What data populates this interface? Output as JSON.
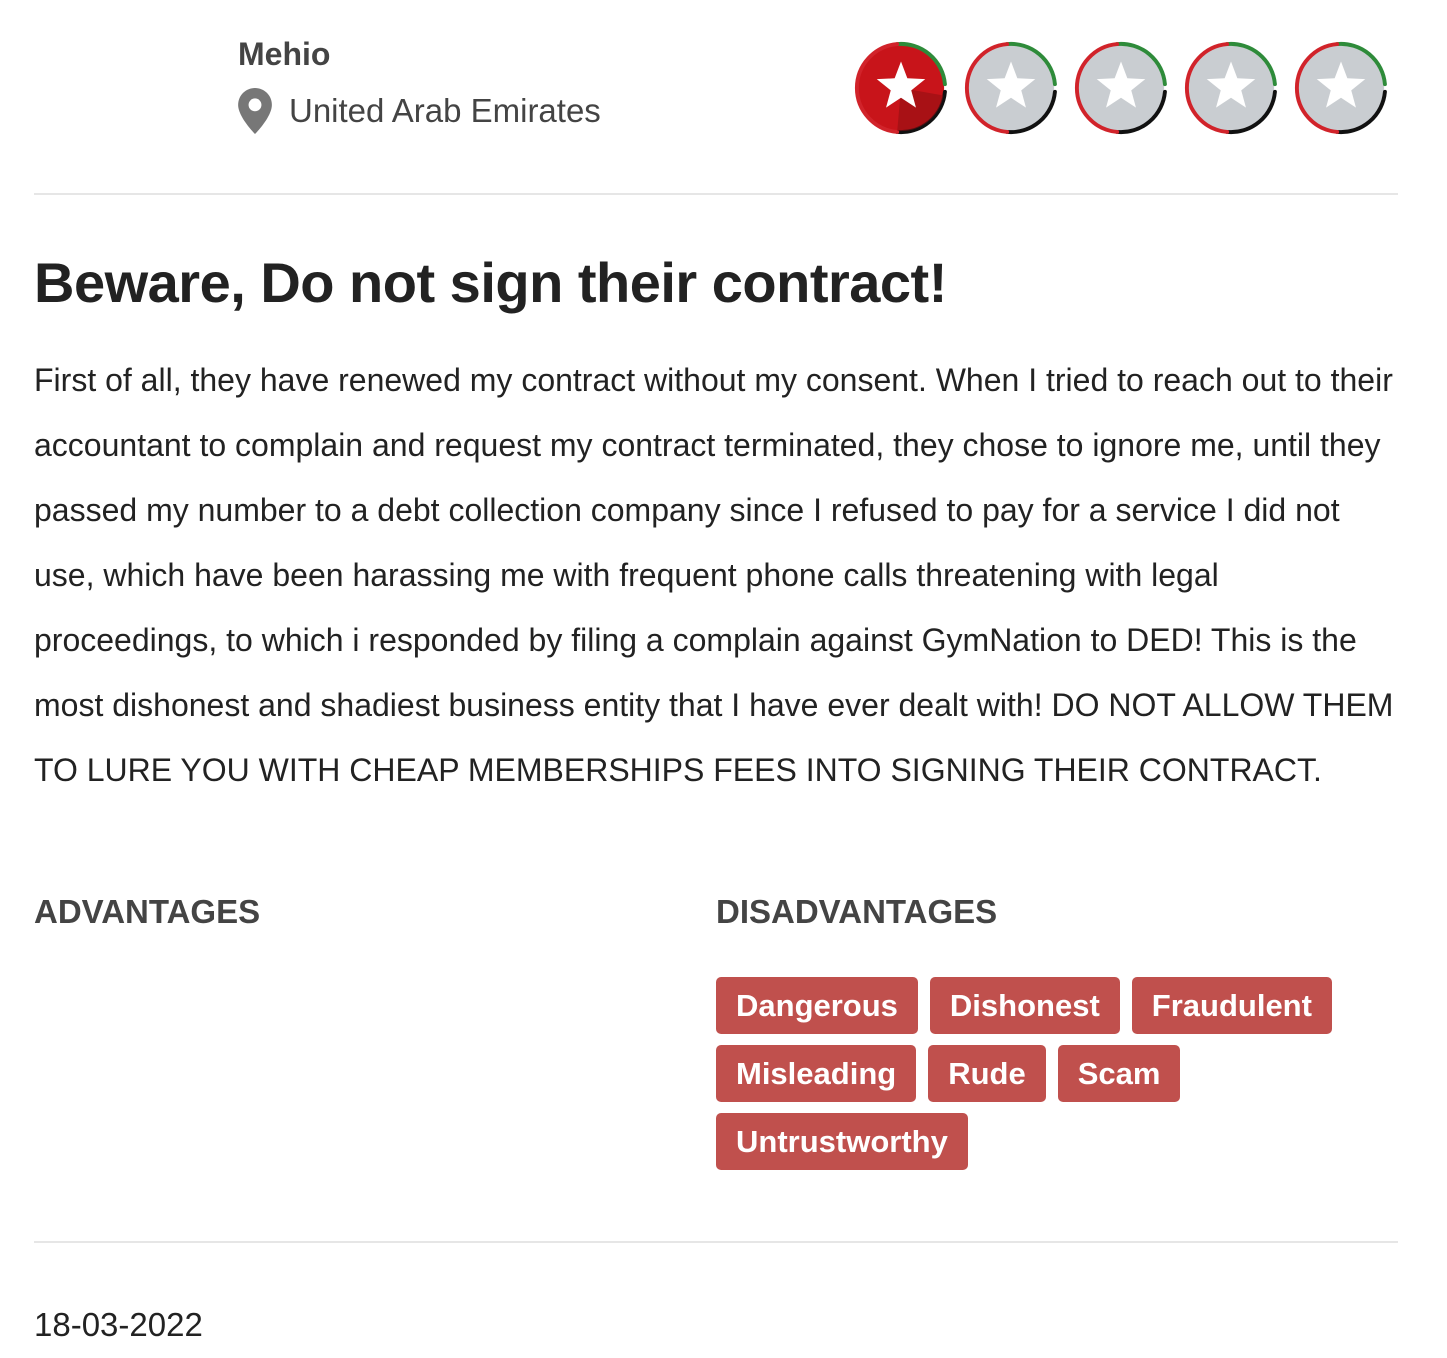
{
  "review": {
    "author": "Mehio",
    "location": "United Arab Emirates",
    "rating": 1,
    "rating_max": 5,
    "title": "Beware, Do not sign their contract!",
    "body": "First of all, they have renewed my contract without my consent. When I tried to reach out to their accountant to complain and request my contract terminated, they chose to ignore me, until they passed my number to a debt collection company since I refused to pay for a service I did not use, which have been harassing me with frequent phone calls threatening with legal proceedings, to which i responded by filing a complain against GymNation to DED! This is the most dishonest and shadiest business entity that I have ever dealt with! DO NOT ALLOW THEM TO LURE YOU WITH CHEAP MEMBERSHIPS FEES INTO SIGNING THEIR CONTRACT.",
    "advantages_heading": "ADVANTAGES",
    "disadvantages_heading": "DISADVANTAGES",
    "advantages": [],
    "disadvantages": [
      "Dangerous",
      "Dishonest",
      "Fraudulent",
      "Misleading",
      "Rude",
      "Scam",
      "Untrustworthy"
    ],
    "date": "18-03-2022"
  },
  "colors": {
    "tag_bg": "#c0504d",
    "star_active": "#c8141a",
    "star_inactive": "#c9cdd1",
    "ring_green": "#2e8b3a",
    "ring_red": "#d1232a",
    "ring_black": "#111111"
  },
  "icons": {
    "location": "map-pin-icon",
    "star": "star-icon"
  }
}
